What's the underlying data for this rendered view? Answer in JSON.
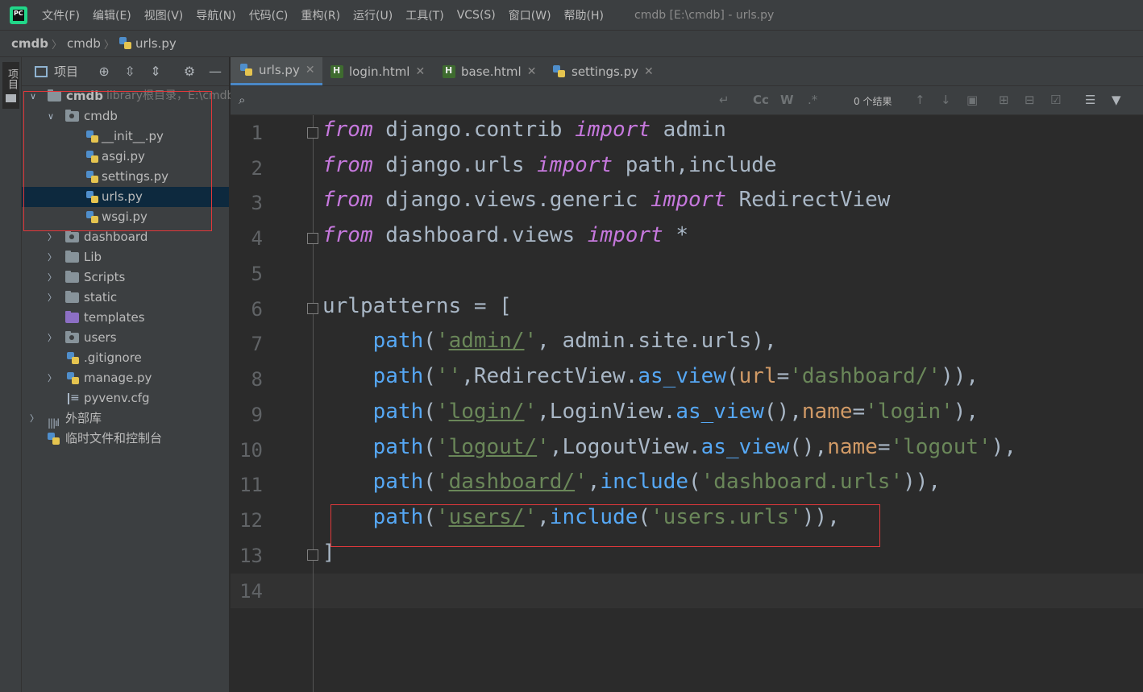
{
  "menu": {
    "items": [
      "文件(F)",
      "编辑(E)",
      "视图(V)",
      "导航(N)",
      "代码(C)",
      "重构(R)",
      "运行(U)",
      "工具(T)",
      "VCS(S)",
      "窗口(W)",
      "帮助(H)"
    ],
    "window_title": "cmdb [E:\\cmdb] - urls.py"
  },
  "breadcrumb": [
    "cmdb",
    "cmdb",
    "urls.py"
  ],
  "toolstrip": {
    "project_tab": "项目"
  },
  "project_panel": {
    "title": "项目",
    "root": {
      "name": "cmdb",
      "hint": "library根目录，E:\\cmdb"
    },
    "tree": [
      {
        "label": "cmdb",
        "type": "folder-module",
        "level": 1,
        "expanded": true
      },
      {
        "label": "__init__.py",
        "type": "python",
        "level": 2
      },
      {
        "label": "asgi.py",
        "type": "python",
        "level": 2
      },
      {
        "label": "settings.py",
        "type": "python",
        "level": 2
      },
      {
        "label": "urls.py",
        "type": "python",
        "level": 2,
        "selected": true
      },
      {
        "label": "wsgi.py",
        "type": "python",
        "level": 2
      },
      {
        "label": "dashboard",
        "type": "folder-module",
        "level": 1,
        "expanded": false
      },
      {
        "label": "Lib",
        "type": "folder",
        "level": 1,
        "expanded": false
      },
      {
        "label": "Scripts",
        "type": "folder",
        "level": 1,
        "expanded": false
      },
      {
        "label": "static",
        "type": "folder",
        "level": 1,
        "expanded": false
      },
      {
        "label": "templates",
        "type": "folder-templates",
        "level": 1
      },
      {
        "label": "users",
        "type": "folder-module",
        "level": 1,
        "expanded": false
      },
      {
        "label": ".gitignore",
        "type": "python",
        "level": 1
      },
      {
        "label": "manage.py",
        "type": "python",
        "level": 1,
        "expanded": false
      },
      {
        "label": "pyvenv.cfg",
        "type": "text",
        "level": 1
      }
    ],
    "external_libs": "外部库",
    "scratches": "临时文件和控制台"
  },
  "tabs": [
    {
      "label": "urls.py",
      "icon": "python-icon",
      "active": true
    },
    {
      "label": "login.html",
      "icon": "html-icon",
      "active": false
    },
    {
      "label": "base.html",
      "icon": "html-icon",
      "active": false
    },
    {
      "label": "settings.py",
      "icon": "python-icon",
      "active": false
    }
  ],
  "search": {
    "results": "0 个结果"
  },
  "code_lines": [
    "from django.contrib import admin",
    "from django.urls import path,include",
    "from django.views.generic import RedirectView",
    "from dashboard.views import *",
    "",
    "urlpatterns = [",
    "    path('admin/', admin.site.urls),",
    "    path('',RedirectView.as_view(url='dashboard/')),",
    "    path('login/',LoginView.as_view(),name='login'),",
    "    path('logout/',LogoutView.as_view(),name='logout'),",
    "    path('dashboard/',include('dashboard.urls')),",
    "    path('users/',include('users.urls')),",
    "]",
    ""
  ],
  "line_numbers": [
    "1",
    "2",
    "3",
    "4",
    "5",
    "6",
    "7",
    "8",
    "9",
    "10",
    "11",
    "12",
    "13",
    "14"
  ],
  "colors": {
    "keyword": "#cc7832",
    "import": "#c678dd",
    "function": "#56a8f5",
    "string": "#6a8759",
    "param": "#d19a66",
    "highlight_box": "#e0383b"
  }
}
